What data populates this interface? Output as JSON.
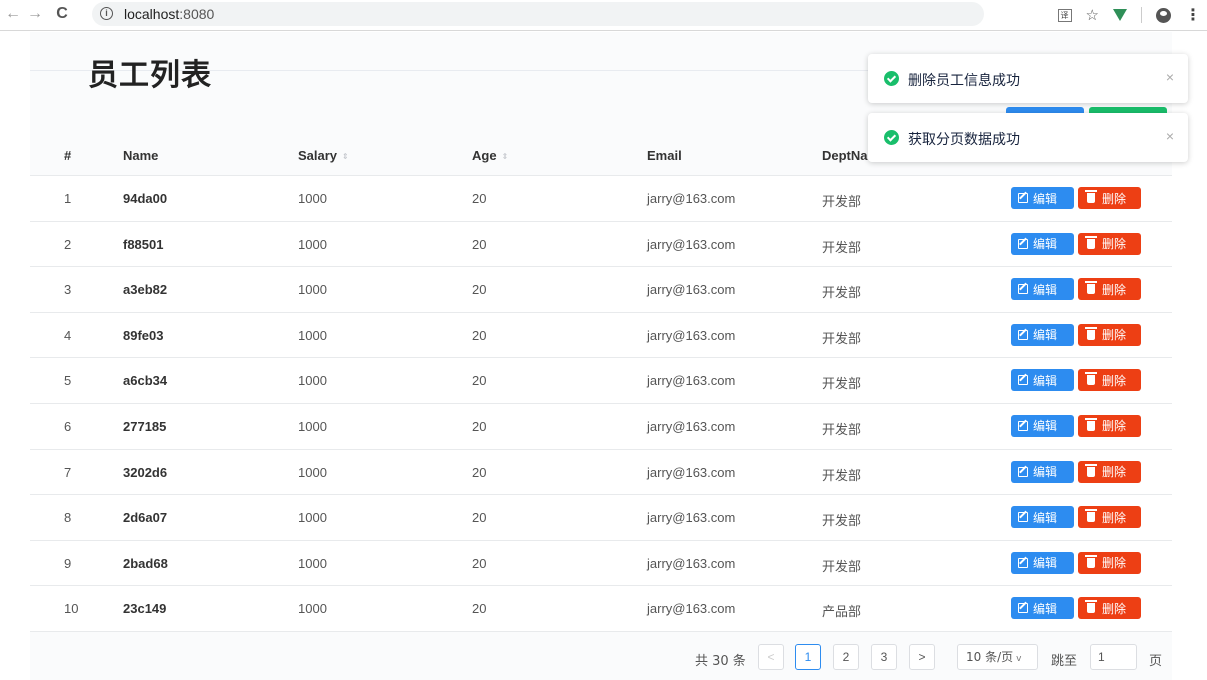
{
  "browser": {
    "url_host": "localhost",
    "url_port": ":8080",
    "back": "←",
    "forward": "→",
    "reload": "C",
    "info": "i",
    "translate_label": "译",
    "star": "☆",
    "menu": "⋮"
  },
  "page": {
    "title": "员工列表"
  },
  "table": {
    "headers": {
      "index": "#",
      "name": "Name",
      "salary": "Salary",
      "age": "Age",
      "email": "Email",
      "dept": "DeptNa"
    },
    "sort_glyph": "⇕",
    "edit_label": "编辑",
    "delete_label": "删除",
    "rows": [
      {
        "index": "1",
        "name": "94da00",
        "salary": "1000",
        "age": "20",
        "email": "jarry@163.com",
        "dept": "开发部"
      },
      {
        "index": "2",
        "name": "f88501",
        "salary": "1000",
        "age": "20",
        "email": "jarry@163.com",
        "dept": "开发部"
      },
      {
        "index": "3",
        "name": "a3eb82",
        "salary": "1000",
        "age": "20",
        "email": "jarry@163.com",
        "dept": "开发部"
      },
      {
        "index": "4",
        "name": "89fe03",
        "salary": "1000",
        "age": "20",
        "email": "jarry@163.com",
        "dept": "开发部"
      },
      {
        "index": "5",
        "name": "a6cb34",
        "salary": "1000",
        "age": "20",
        "email": "jarry@163.com",
        "dept": "开发部"
      },
      {
        "index": "6",
        "name": "277185",
        "salary": "1000",
        "age": "20",
        "email": "jarry@163.com",
        "dept": "开发部"
      },
      {
        "index": "7",
        "name": "3202d6",
        "salary": "1000",
        "age": "20",
        "email": "jarry@163.com",
        "dept": "开发部"
      },
      {
        "index": "8",
        "name": "2d6a07",
        "salary": "1000",
        "age": "20",
        "email": "jarry@163.com",
        "dept": "开发部"
      },
      {
        "index": "9",
        "name": "2bad68",
        "salary": "1000",
        "age": "20",
        "email": "jarry@163.com",
        "dept": "开发部"
      },
      {
        "index": "10",
        "name": "23c149",
        "salary": "1000",
        "age": "20",
        "email": "jarry@163.com",
        "dept": "产品部"
      }
    ]
  },
  "pagination": {
    "total": "共 30 条",
    "prev": "<",
    "next": ">",
    "pages": [
      "1",
      "2",
      "3"
    ],
    "current_page": "1",
    "page_size": "10 条/页",
    "size_caret": "v",
    "jump_label": "跳至",
    "jump_value": "1",
    "page_suffix": "页"
  },
  "notifications": [
    {
      "text": "删除员工信息成功",
      "close": "×"
    },
    {
      "text": "获取分页数据成功",
      "close": "×"
    }
  ],
  "colors": {
    "primary": "#2d8cf0",
    "success": "#19be6b",
    "danger": "#ed3f14"
  }
}
